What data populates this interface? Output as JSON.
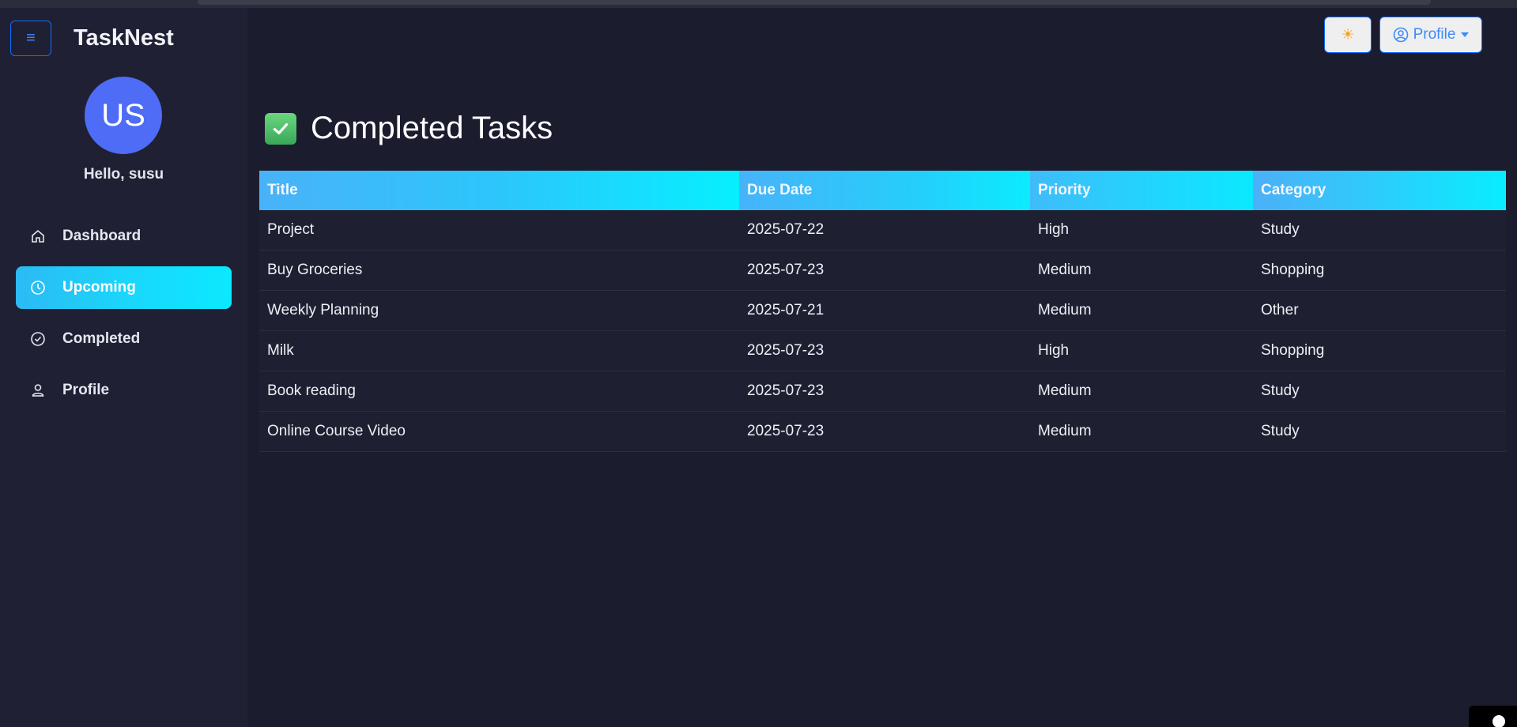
{
  "app": {
    "brand": "TaskNest"
  },
  "sidebar": {
    "avatar_initials": "US",
    "greeting": "Hello, susu",
    "items": [
      {
        "label": "Dashboard",
        "icon": "home-icon",
        "active": false
      },
      {
        "label": "Upcoming",
        "icon": "clock-icon",
        "active": true
      },
      {
        "label": "Completed",
        "icon": "check-circle-icon",
        "active": false
      },
      {
        "label": "Profile",
        "icon": "person-icon",
        "active": false
      }
    ]
  },
  "header": {
    "theme_toggle_icon": "sun-icon",
    "profile_label": "Profile"
  },
  "main": {
    "title": "Completed Tasks",
    "table": {
      "columns": [
        "Title",
        "Due Date",
        "Priority",
        "Category"
      ],
      "rows": [
        [
          "Project",
          "2025-07-22",
          "High",
          "Study"
        ],
        [
          "Buy Groceries",
          "2025-07-23",
          "Medium",
          "Shopping"
        ],
        [
          "Weekly Planning",
          "2025-07-21",
          "Medium",
          "Other"
        ],
        [
          "Milk",
          "2025-07-23",
          "High",
          "Shopping"
        ],
        [
          "Book reading",
          "2025-07-23",
          "Medium",
          "Study"
        ],
        [
          "Online Course Video",
          "2025-07-23",
          "Medium",
          "Study"
        ]
      ]
    }
  },
  "colors": {
    "background": "#1b1c2e",
    "sidebar": "#1f2033",
    "accent_gradient_start": "#2cbaf3",
    "accent_gradient_end": "#0ae9ff",
    "button_border": "#0d6efd",
    "avatar": "#4e6cf5"
  }
}
